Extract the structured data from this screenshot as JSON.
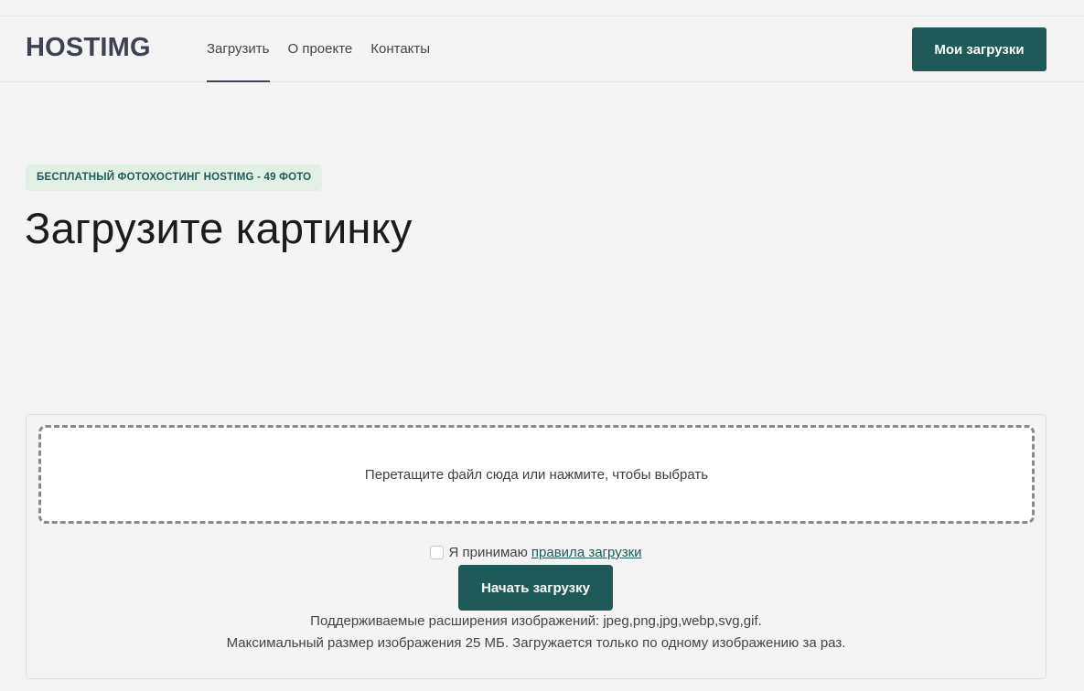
{
  "header": {
    "logo": "HOSTIMG",
    "nav": [
      {
        "label": "Загрузить",
        "active": true
      },
      {
        "label": "О проекте",
        "active": false
      },
      {
        "label": "Контакты",
        "active": false
      }
    ],
    "my_uploads_label": "Мои загрузки"
  },
  "hero": {
    "badge": "БЕСПЛАТНЫЙ ФОТОХОСТИНГ HOSTIMG - 49 ФОТО",
    "title": "Загрузите картинку"
  },
  "upload": {
    "dropzone_text": "Перетащите файл сюда или нажмите, чтобы выбрать",
    "accept_text": "Я принимаю",
    "rules_link": "правила загрузки",
    "accept_checked": false,
    "start_label": "Начать загрузку",
    "supported_formats": "Поддерживаемые расширения изображений: jpeg,png,jpg,webp,svg,gif.",
    "max_size_note": "Максимальный размер изображения 25 МБ. Загружается только по одному изображению за раз."
  },
  "colors": {
    "accent": "#1e5b58",
    "badge_bg": "#e2efe5",
    "background": "#f4f4f4"
  }
}
